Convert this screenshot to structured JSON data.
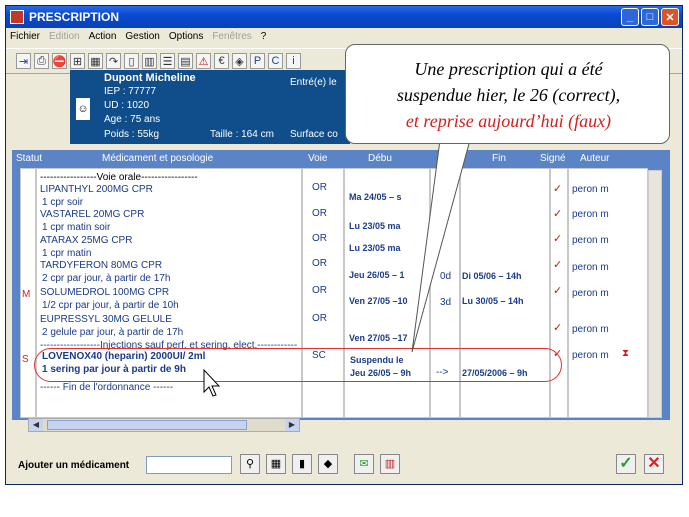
{
  "window": {
    "title": "PRESCRIPTION",
    "menus": [
      {
        "label": "Fichier",
        "disabled": false
      },
      {
        "label": "Edition",
        "disabled": true
      },
      {
        "label": "Action",
        "disabled": false
      },
      {
        "label": "Gestion",
        "disabled": false
      },
      {
        "label": "Options",
        "disabled": false
      },
      {
        "label": "Fenêtres",
        "disabled": true
      },
      {
        "label": "?",
        "disabled": false
      }
    ]
  },
  "patient": {
    "name": "Dupont Micheline",
    "iep": "IEP : 77777",
    "ud": "UD : 1020",
    "age": "Age : 75 ans",
    "weight": "Poids : 55kg",
    "height": "Taille : 164 cm",
    "surface": "Surface co",
    "entry": "Entré(e) le"
  },
  "table": {
    "headers": {
      "statut": "Statut",
      "medicament": "Médicament et posologie",
      "voie": "Voie",
      "debut": "Débu",
      "fin": "Fin",
      "signe": "Signé",
      "auteur": "Auteur"
    },
    "section_oral": "-----------------Voie orale-----------------",
    "section_inj": "------------------Injections sauf perf. et sering. elect.------------",
    "end": "------ Fin de l'ordonnance ------",
    "rows": [
      {
        "status": "",
        "drug": "LIPANTHYL 200MG CPR",
        "dose": "1 cpr soir",
        "voie": "OR",
        "debut": "Ma 24/05 – s",
        "dur": "",
        "fin": "",
        "signed": "✓",
        "author": "peron m"
      },
      {
        "status": "",
        "drug": "VASTAREL 20MG CPR",
        "dose": "1 cpr matin soir",
        "voie": "OR",
        "debut": "Lu 23/05  ma",
        "dur": "",
        "fin": "",
        "signed": "✓",
        "author": "peron m"
      },
      {
        "status": "",
        "drug": "ATARAX 25MG CPR",
        "dose": "1 cpr matin",
        "voie": "OR",
        "debut": "Lu 23/05  ma",
        "dur": "",
        "fin": "",
        "signed": "✓",
        "author": "peron m"
      },
      {
        "status": "",
        "drug": "TARDYFERON 80MG CPR",
        "dose": "2 cpr par jour,  à partir de 17h",
        "voie": "OR",
        "debut": "Jeu 26/05 – 1",
        "dur": "0d",
        "fin": "Di 05/06 – 14h",
        "signed": "✓",
        "author": "peron m"
      },
      {
        "status": "M",
        "drug": "SOLUMEDROL 100MG CPR",
        "dose": "1/2 cpr par jour,  à partir de 10h",
        "voie": "OR",
        "debut": "Ven 27/05 –10",
        "dur": "3d",
        "fin": "Lu 30/05 – 14h",
        "signed": "✓",
        "author": "peron m"
      },
      {
        "status": "",
        "drug": "EUPRESSYL 30MG GELULE",
        "dose": "2 gelule par jour,  à partir de 17h",
        "voie": "OR",
        "debut": "Ven 27/05 –17",
        "dur": "",
        "fin": "",
        "signed": "✓",
        "author": "peron m"
      }
    ],
    "inj_row": {
      "status": "S",
      "drug": "LOVENOX40 (heparin) 2000UI/ 2ml",
      "dose": "1 sering par jour à partir de 9h",
      "voie": "SC",
      "debut_1": "Suspendu le",
      "debut_2": "Jeu 26/05 – 9h",
      "dur": "-->",
      "fin": "27/05/2006 – 9h",
      "signed": "✓",
      "author": "peron m",
      "flag": "⧗"
    }
  },
  "bottom": {
    "add_label": "Ajouter un médicament"
  },
  "callout": {
    "line1": "Une prescription qui a été",
    "line2": "suspendue hier, le 26 (correct),",
    "line3": "et reprise aujourd’hui (faux)"
  },
  "colors": {
    "title_blue": "#0a4ad0",
    "header_blue": "#5b84c6",
    "patient_blue": "#0f4e8a",
    "highlight_red": "#e03030",
    "text_blue": "#1a3a8a"
  }
}
